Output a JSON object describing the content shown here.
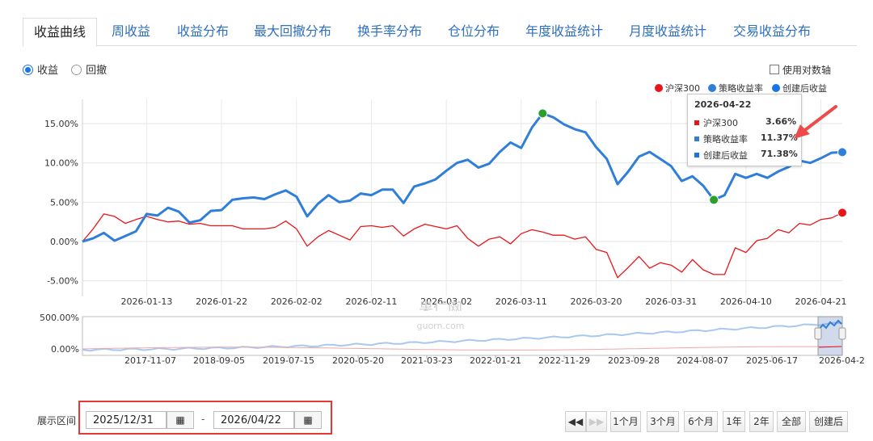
{
  "tabs": [
    "收益曲线",
    "周收益",
    "收益分布",
    "最大回撤分布",
    "换手率分布",
    "仓位分布",
    "年度收益统计",
    "月度收益统计",
    "交易收益分布"
  ],
  "active_tab": "收益曲线",
  "mode_options": {
    "returns": "收益",
    "drawdown": "回撤",
    "selected": "收益"
  },
  "log_axis": {
    "label": "使用对数轴",
    "checked": false
  },
  "legend": [
    {
      "name": "沪深300",
      "color": "#e8151b"
    },
    {
      "name": "策略收益率",
      "color": "#2f7ed8"
    },
    {
      "name": "创建后收益",
      "color": "#1a73e8"
    }
  ],
  "tooltip": {
    "date": "2026-04-22",
    "rows": [
      {
        "name": "沪深300",
        "value": "3.66%",
        "color": "#e8151b"
      },
      {
        "name": "策略收益率",
        "value": "11.37%",
        "color": "#2f7ed8"
      },
      {
        "name": "创建后收益",
        "value": "71.38%",
        "color": "#1a73e8"
      }
    ]
  },
  "watermark": {
    "text": "果仁网",
    "url": "guorn.com"
  },
  "chart_data": {
    "type": "line",
    "y_ticks": [
      "15.00%",
      "10.00%",
      "5.00%",
      "0.00%",
      "-5.00%"
    ],
    "ylim": [
      -6.5,
      18.5
    ],
    "x_ticks": [
      "2026-01-13",
      "2026-01-22",
      "2026-02-02",
      "2026-02-11",
      "2026-03-02",
      "2026-03-11",
      "2026-03-20",
      "2026-03-31",
      "2026-04-10",
      "2026-04-21"
    ],
    "x_tick_index": [
      6,
      13,
      20,
      27,
      34,
      41,
      48,
      55,
      62,
      69
    ],
    "series": [
      {
        "name": "策略收益率",
        "color": "#2f7ed8",
        "values": [
          0.0,
          0.4,
          1.1,
          0.1,
          0.7,
          1.3,
          3.5,
          3.3,
          4.3,
          3.8,
          2.4,
          2.7,
          3.9,
          4.0,
          5.3,
          5.5,
          5.6,
          5.4,
          6.0,
          6.5,
          5.7,
          3.2,
          4.8,
          5.9,
          5.0,
          5.2,
          6.1,
          5.9,
          6.6,
          6.6,
          4.9,
          7.0,
          7.4,
          7.9,
          9.0,
          10.0,
          10.4,
          9.4,
          9.9,
          11.4,
          12.6,
          11.9,
          14.5,
          16.3,
          15.8,
          14.9,
          14.3,
          13.9,
          12.0,
          10.5,
          7.3,
          8.9,
          10.8,
          11.4,
          10.5,
          9.6,
          7.7,
          8.3,
          7.1,
          5.3,
          5.9,
          8.6,
          8.1,
          8.6,
          8.1,
          8.9,
          9.5,
          10.3,
          10.0,
          10.6,
          11.3,
          11.37
        ],
        "markers": [
          {
            "index": 43,
            "color": "#2ca02c"
          },
          {
            "index": 59,
            "color": "#2ca02c"
          },
          {
            "index": 71,
            "color": "#2f7ed8"
          }
        ]
      },
      {
        "name": "沪深300",
        "color": "#e8151b",
        "values": [
          0.0,
          1.6,
          3.5,
          3.2,
          2.3,
          2.8,
          3.2,
          2.8,
          2.5,
          2.6,
          2.2,
          2.3,
          2.0,
          2.0,
          2.0,
          1.6,
          1.6,
          1.6,
          1.8,
          2.6,
          1.6,
          -0.6,
          0.6,
          1.4,
          0.8,
          0.2,
          1.9,
          2.0,
          1.8,
          2.0,
          0.7,
          1.6,
          2.2,
          1.9,
          1.6,
          2.0,
          0.4,
          -0.6,
          0.3,
          0.6,
          -0.3,
          1.0,
          1.5,
          1.2,
          0.8,
          0.8,
          0.3,
          0.6,
          -1.0,
          -1.4,
          -4.6,
          -3.3,
          -1.9,
          -3.4,
          -2.7,
          -3.0,
          -3.9,
          -2.3,
          -3.6,
          -4.2,
          -4.2,
          -0.8,
          -1.4,
          0.1,
          0.4,
          1.5,
          1.1,
          2.3,
          2.1,
          2.8,
          3.0,
          3.66
        ],
        "markers": [
          {
            "index": 71,
            "color": "#e8151b"
          }
        ]
      }
    ],
    "navigator": {
      "y_ticks": [
        "500.00%",
        "0.00%"
      ],
      "x_ticks": [
        "2017-11-07",
        "2018-09-05",
        "2019-07-15",
        "2020-05-20",
        "2021-03-23",
        "2022-01-21",
        "2022-11-29",
        "2023-09-28",
        "2024-08-07",
        "2025-06-17",
        "2026-04-2"
      ]
    }
  },
  "date_range": {
    "label": "展示区间",
    "start": "2025/12/31",
    "end": "2026/04/22",
    "separator": "-"
  },
  "range_buttons": [
    "1个月",
    "3个月",
    "6个月",
    "1年",
    "2年",
    "全部",
    "创建后"
  ]
}
